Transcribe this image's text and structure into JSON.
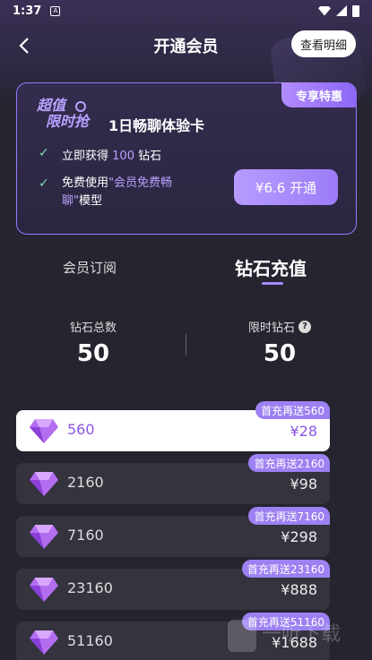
{
  "status": {
    "time": "1:37"
  },
  "header": {
    "title": "开通会员",
    "detail_button": "查看明细"
  },
  "promo": {
    "tag": "专享特惠",
    "logo_line1": "超值",
    "logo_line2": "限时抢",
    "title": "1日畅聊体验卡",
    "benefit1_prefix": "立即获得",
    "benefit1_highlight": "100",
    "benefit1_suffix": "钻石",
    "benefit2_prefix": "免费使用",
    "benefit2_highlight": "\"会员免费畅聊\"",
    "benefit2_suffix": "模型",
    "button": "¥6.6 开通"
  },
  "tabs": {
    "subscribe": "会员订阅",
    "diamond": "钻石充值"
  },
  "stats": {
    "total_label": "钻石总数",
    "total_value": "50",
    "limited_label": "限时钻石",
    "limited_value": "50"
  },
  "packages": [
    {
      "amount": "560",
      "price": "¥28",
      "badge": "首充再送560",
      "selected": true
    },
    {
      "amount": "2160",
      "price": "¥98",
      "badge": "首充再送2160",
      "selected": false
    },
    {
      "amount": "7160",
      "price": "¥298",
      "badge": "首充再送7160",
      "selected": false
    },
    {
      "amount": "23160",
      "price": "¥888",
      "badge": "首充再送23160",
      "selected": false
    },
    {
      "amount": "51160",
      "price": "¥1688",
      "badge": "首充再送51160",
      "selected": false
    }
  ],
  "watermark": "一听下载",
  "colors": {
    "accent": "#9d80f2",
    "background": "#25242f"
  }
}
